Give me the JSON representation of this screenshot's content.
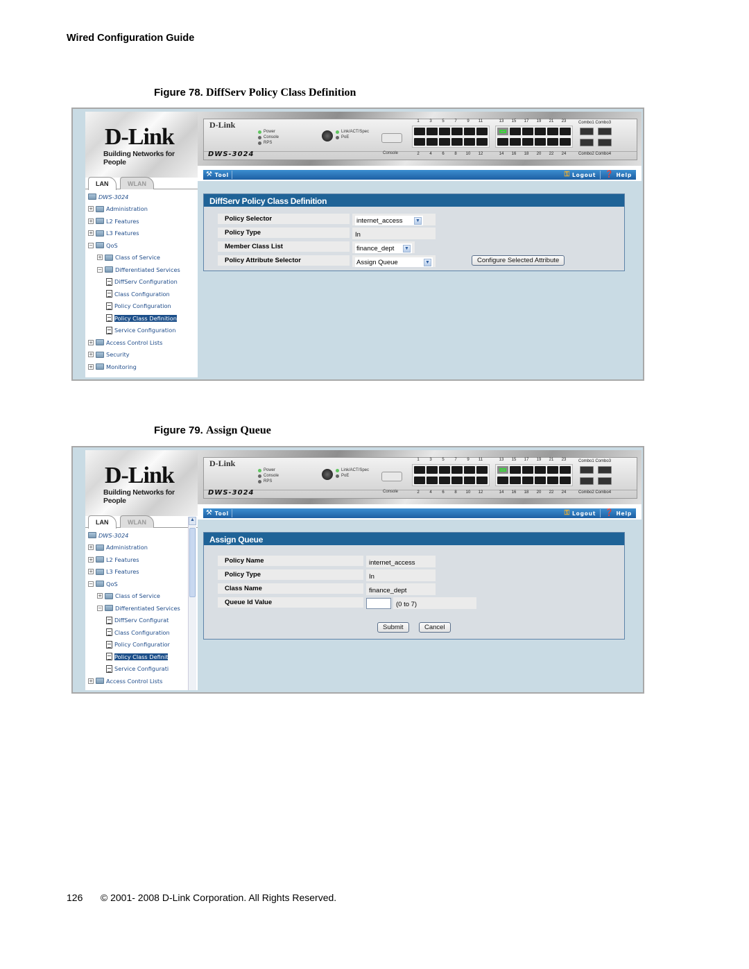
{
  "document": {
    "header": "Wired Configuration Guide",
    "footer": {
      "page_number": "126",
      "copyright": "© 2001- 2008 D-Link Corporation. All Rights Reserved."
    }
  },
  "figures": [
    {
      "number_label": "Figure 78.",
      "title": "DiffServ Policy Class Definition"
    },
    {
      "number_label": "Figure 79.",
      "title": "Assign Queue"
    }
  ],
  "app": {
    "logo": "D-Link",
    "logo_registered": "®",
    "tagline": "Building Networks for People",
    "tabs": [
      "LAN",
      "WLAN"
    ],
    "switch": {
      "brand": "D-Link",
      "model": "DWS-3024",
      "leds_left": [
        "Power",
        "Console",
        "RPS"
      ],
      "leds_right": [
        "Link/ACT/Spec",
        "PoE"
      ],
      "console_label": "Console",
      "ports_top_group1": [
        "1",
        "3",
        "5",
        "7",
        "9",
        "11"
      ],
      "ports_top_group2": [
        "13",
        "15",
        "17",
        "19",
        "21",
        "23"
      ],
      "ports_bottom_group1": [
        "2",
        "4",
        "6",
        "8",
        "10",
        "12"
      ],
      "ports_bottom_group2": [
        "14",
        "16",
        "18",
        "20",
        "22",
        "24"
      ],
      "combo_top": "Combo1 Combo3",
      "combo_bottom": "Combo2 Combo4",
      "active_port": "13"
    },
    "toolbar": {
      "tool": "Tool",
      "logout": "Logout",
      "help": "Help"
    },
    "colors": {
      "toolbar_blue": "#1e5fa3",
      "panel_title_blue": "#1f6397",
      "tree_text": "#1f4c8a",
      "content_bg": "#c9dbe4"
    }
  },
  "screen1": {
    "tree": [
      {
        "label": "DWS-3024",
        "level": 0,
        "type": "root"
      },
      {
        "label": "Administration",
        "level": 0,
        "type": "folder",
        "expander": "+"
      },
      {
        "label": "L2 Features",
        "level": 0,
        "type": "folder",
        "expander": "+"
      },
      {
        "label": "L3 Features",
        "level": 0,
        "type": "folder",
        "expander": "+"
      },
      {
        "label": "QoS",
        "level": 0,
        "type": "folder",
        "expander": "-"
      },
      {
        "label": "Class of Service",
        "level": 1,
        "type": "folder",
        "expander": "+"
      },
      {
        "label": "Differentiated Services",
        "level": 1,
        "type": "folder",
        "expander": "-"
      },
      {
        "label": "DiffServ Configuration",
        "level": 2,
        "type": "page"
      },
      {
        "label": "Class Configuration",
        "level": 2,
        "type": "page"
      },
      {
        "label": "Policy Configuration",
        "level": 2,
        "type": "page"
      },
      {
        "label": "Policy Class Definition",
        "level": 2,
        "type": "page",
        "selected": true
      },
      {
        "label": "Service Configuration",
        "level": 2,
        "type": "page"
      },
      {
        "label": "Access Control Lists",
        "level": 0,
        "type": "folder",
        "expander": "+"
      },
      {
        "label": "Security",
        "level": 0,
        "type": "folder",
        "expander": "+"
      },
      {
        "label": "Monitoring",
        "level": 0,
        "type": "folder",
        "expander": "+"
      }
    ],
    "panel_title": "DiffServ Policy Class Definition",
    "rows": [
      {
        "label": "Policy Selector",
        "value": "internet_access",
        "control": "select"
      },
      {
        "label": "Policy Type",
        "value": "In",
        "control": "text"
      },
      {
        "label": "Member Class List",
        "value": "finance_dept",
        "control": "select"
      },
      {
        "label": "Policy Attribute Selector",
        "value": "Assign Queue",
        "control": "select"
      }
    ],
    "configure_button": "Configure Selected Attribute"
  },
  "screen2": {
    "tree": [
      {
        "label": "DWS-3024",
        "level": 0,
        "type": "root"
      },
      {
        "label": "Administration",
        "level": 0,
        "type": "folder",
        "expander": "+"
      },
      {
        "label": "L2 Features",
        "level": 0,
        "type": "folder",
        "expander": "+"
      },
      {
        "label": "L3 Features",
        "level": 0,
        "type": "folder",
        "expander": "+"
      },
      {
        "label": "QoS",
        "level": 0,
        "type": "folder",
        "expander": "-"
      },
      {
        "label": "Class of Service",
        "level": 1,
        "type": "folder",
        "expander": "+"
      },
      {
        "label": "Differentiated Services",
        "level": 1,
        "type": "folder",
        "expander": "-"
      },
      {
        "label": "DiffServ Configurat",
        "level": 2,
        "type": "page"
      },
      {
        "label": "Class Configuration",
        "level": 2,
        "type": "page"
      },
      {
        "label": "Policy Configuratior",
        "level": 2,
        "type": "page"
      },
      {
        "label": "Policy Class Definit",
        "level": 2,
        "type": "page",
        "selected": true
      },
      {
        "label": "Service Configurati",
        "level": 2,
        "type": "page"
      },
      {
        "label": "Access Control Lists",
        "level": 0,
        "type": "folder",
        "expander": "+"
      }
    ],
    "panel_title": "Assign Queue",
    "rows": [
      {
        "label": "Policy Name",
        "value": "internet_access"
      },
      {
        "label": "Policy Type",
        "value": "In"
      },
      {
        "label": "Class Name",
        "value": "finance_dept"
      },
      {
        "label": "Queue Id Value",
        "value": "",
        "hint": "(0 to 7)"
      }
    ],
    "submit_button": "Submit",
    "cancel_button": "Cancel"
  }
}
